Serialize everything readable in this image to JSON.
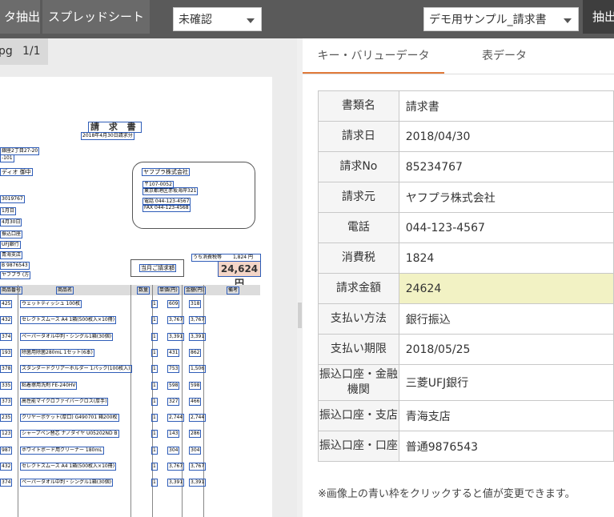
{
  "toolbar": {
    "extract_tab": "タ抽出",
    "spreadsheet_tab": "スプレッドシート",
    "status_select": "未確認",
    "template_select": "デモ用サンプル_請求書",
    "extract_button": "抽出"
  },
  "document": {
    "page_ext": "pg",
    "page_indicator": "1/1",
    "title": "請 求 書",
    "date_line": "2018年4月30日請求分",
    "left_lines": [
      "銀座2丁目27-20",
      "-101",
      "ディオ 御中",
      "3019767",
      "1月日",
      "4月30日",
      "振込口座",
      "UFJ銀行",
      "青海支店",
      "B 9876543",
      "ヤフプラ (方"
    ],
    "company": "ヤフプラ株式会社",
    "company_addr1": "〒107-0052",
    "company_addr2": "東京都港区赤坂海岸321",
    "tel": "電話 044-123-4567",
    "fax": "FAX 044-123-4568",
    "tax_label": "うち消費税等",
    "tax_value": "1,824 円",
    "total_label": "当月ご請求額",
    "total_value": "24,624円",
    "table_headers": [
      "商品番号",
      "商品名",
      "数量",
      "単価(円)",
      "金額(円)",
      "備考"
    ],
    "rows": [
      {
        "code": "425",
        "name": "ウェットティッシュ 100枚",
        "qty": "1",
        "price": "609",
        "amount": "318"
      },
      {
        "code": "432",
        "name": "セレクトスムース A4 1箱(500枚入×10冊)",
        "qty": "1",
        "price": "3,767",
        "amount": "3,767"
      },
      {
        "code": "374",
        "name": "ペーパータオル中判・シングル1箱(30個)",
        "qty": "1",
        "price": "3,391",
        "amount": "3,391"
      },
      {
        "code": "193",
        "name": "除菌用除菌280mL 1セット(6本)",
        "qty": "1",
        "price": "431",
        "amount": "862"
      },
      {
        "code": "378",
        "name": "スタンダードクリアーホルダー 1パック(100枚入)",
        "qty": "1",
        "price": "753",
        "amount": "1,506"
      },
      {
        "code": "335",
        "name": "粘着擦用洗剤 FE-240HV",
        "qty": "1",
        "price": "598",
        "amount": "598"
      },
      {
        "code": "373",
        "name": "高性能マイクロファイバークロス(厚手)",
        "qty": "1",
        "price": "327",
        "amount": "466"
      },
      {
        "code": "235",
        "name": "クリヤーポケット(厚口) G490701 箱200枚",
        "qty": "1",
        "price": "2,744",
        "amount": "2,744"
      },
      {
        "code": "123",
        "name": "シャープペン替芯 ナノダイヤ U05202ND B",
        "qty": "1",
        "price": "143",
        "amount": "286"
      },
      {
        "code": "987",
        "name": "ホワイトボード用クリーナー 180mL",
        "qty": "1",
        "price": "304",
        "amount": "304"
      },
      {
        "code": "432",
        "name": "セレクトスムース A4 1箱(500枚入×10冊)",
        "qty": "1",
        "price": "3,767",
        "amount": "3,767"
      },
      {
        "code": "374",
        "name": "ペーパータオル中判・シングル1箱(30個)",
        "qty": "1",
        "price": "3,391",
        "amount": "3,391"
      }
    ]
  },
  "right": {
    "tab_kv": "キー・バリューデータ",
    "tab_table": "表データ",
    "rows": [
      {
        "key": "書類名",
        "value": "請求書"
      },
      {
        "key": "請求日",
        "value": "2018/04/30"
      },
      {
        "key": "請求No",
        "value": "85234767"
      },
      {
        "key": "請求元",
        "value": "ヤフプラ株式会社"
      },
      {
        "key": "電話",
        "value": "044-123-4567"
      },
      {
        "key": "消費税",
        "value": "1824"
      },
      {
        "key": "請求金額",
        "value": "24624"
      },
      {
        "key": "支払い方法",
        "value": "銀行振込"
      },
      {
        "key": "支払い期限",
        "value": "2018/05/25"
      },
      {
        "key": "振込口座・金融機関",
        "value": "三菱UFJ銀行"
      },
      {
        "key": "振込口座・支店",
        "value": "青海支店"
      },
      {
        "key": "振込口座・口座",
        "value": "普通9876543"
      }
    ],
    "note": "※画像上の青い枠をクリックすると値が変更できます。"
  },
  "colors": {
    "toolbar": "#5a5a5a",
    "accent": "#e07a3a",
    "box_border": "#2f5db8",
    "highlight": "#f2f2c4"
  }
}
